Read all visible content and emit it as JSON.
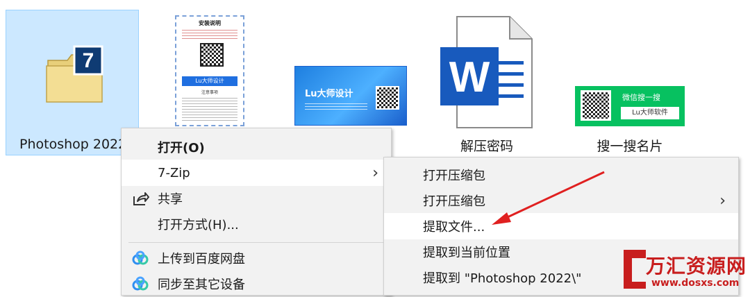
{
  "desktop": {
    "files": [
      {
        "label": "Photoshop 2022",
        "icon": "folder-7zip-icon"
      },
      {
        "label": "",
        "icon": "install-guide-poster-icon"
      },
      {
        "label": "",
        "icon": "business-card-image-icon"
      },
      {
        "label": "解压密码",
        "icon": "word-document-icon"
      },
      {
        "label": "搜一搜名片",
        "icon": "wechat-card-image-icon"
      }
    ],
    "poster": {
      "title": "安装说明",
      "brand": "Lu大师设计",
      "footer": "注意事项"
    },
    "card": {
      "brand": "Lu大师设计"
    },
    "wechat_card": {
      "line1": "微信搜一搜",
      "line2": "Lu大师软件"
    }
  },
  "context_menu": {
    "items": [
      {
        "label": "打开(O)",
        "bold": true
      },
      {
        "label": "7-Zip",
        "submenu": true
      },
      {
        "label": "共享",
        "icon": "share-icon"
      },
      {
        "label": "打开方式(H)..."
      },
      {
        "label": "上传到百度网盘",
        "icon": "baidu-netdisk-icon"
      },
      {
        "label": "同步至其它设备",
        "icon": "baidu-netdisk-icon"
      }
    ]
  },
  "submenu": {
    "items": [
      {
        "label": "打开压缩包"
      },
      {
        "label": "打开压缩包",
        "submenu": true
      },
      {
        "label": "提取文件..."
      },
      {
        "label": "提取到当前位置"
      },
      {
        "label": "提取到 \"Photoshop 2022\\\""
      }
    ]
  },
  "watermark": {
    "name": "万汇资源网",
    "url": "www.dosxs.com"
  },
  "colors": {
    "selection": "#cce8ff",
    "arrow": "#e02020",
    "word_blue": "#185abd",
    "wechat_green": "#07c160"
  }
}
